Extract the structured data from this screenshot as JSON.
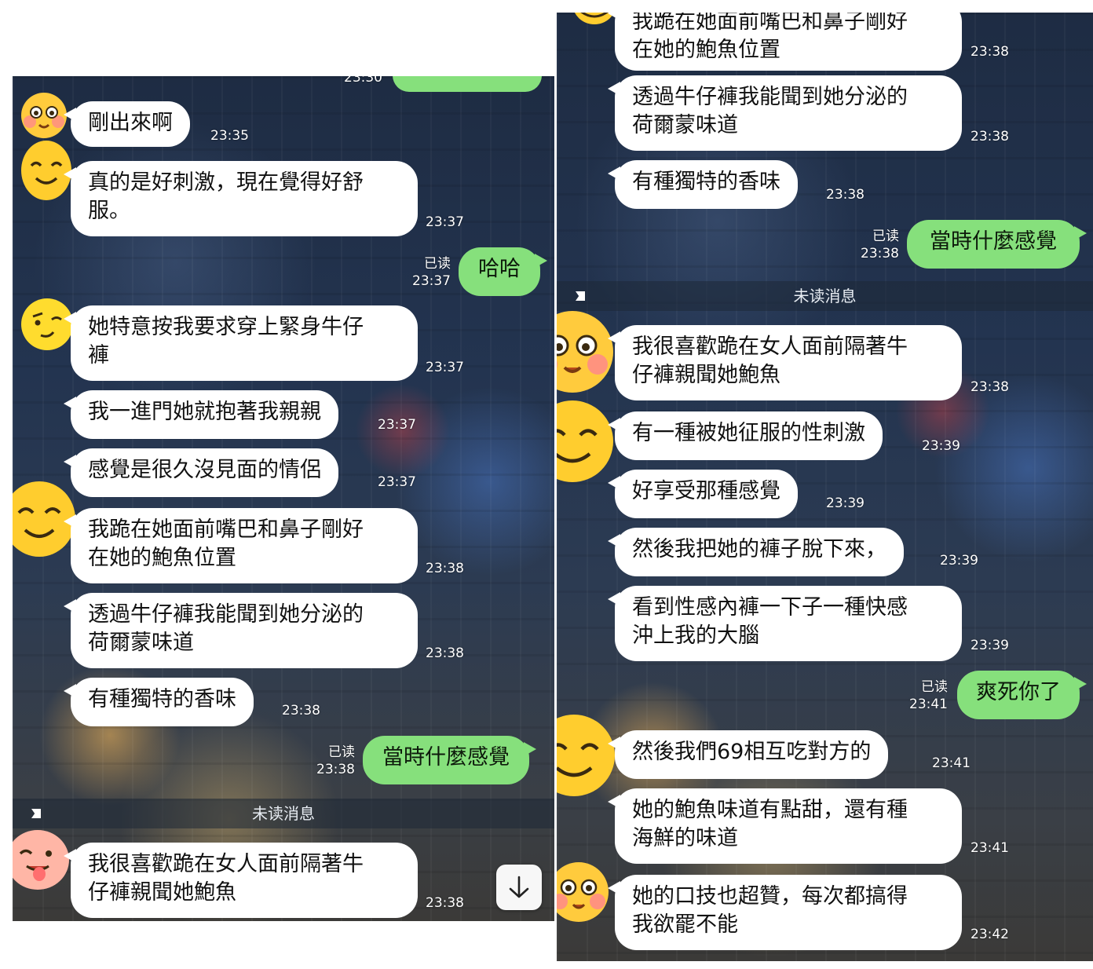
{
  "left": {
    "top_partial_time": "23:30",
    "messages": [
      {
        "text": "剛出來啊",
        "time": "23:35"
      },
      {
        "text": "真的是好刺激，現在覺得好舒\n服。",
        "time": "23:37"
      },
      {
        "text": "哈哈",
        "read": "已读",
        "time": "23:37"
      },
      {
        "text": "她特意按我要求穿上緊身牛仔\n褲",
        "time": "23:37"
      },
      {
        "text": "我一進門她就抱著我親親",
        "time": "23:37"
      },
      {
        "text": "感覺是很久沒見面的情侶",
        "time": "23:37"
      },
      {
        "text": "我跪在她面前嘴巴和鼻子剛好\n在她的鮑魚位置",
        "time": "23:38"
      },
      {
        "text": "透過牛仔褲我能聞到她分泌的\n荷爾蒙味道",
        "time": "23:38"
      },
      {
        "text": "有種獨特的香味",
        "time": "23:38"
      },
      {
        "text": "當時什麼感覺",
        "read": "已读",
        "time": "23:38"
      },
      {
        "text": "我很喜歡跪在女人面前隔著牛\n仔褲親聞她鮑魚",
        "time": "23:38"
      }
    ],
    "unread_label": "未读消息"
  },
  "right": {
    "messages": [
      {
        "text": "我跪在她面前嘴巴和鼻子剛好\n在她的鮑魚位置",
        "time": "23:38"
      },
      {
        "text": "透過牛仔褲我能聞到她分泌的\n荷爾蒙味道",
        "time": "23:38"
      },
      {
        "text": "有種獨特的香味",
        "time": "23:38"
      },
      {
        "text": "當時什麼感覺",
        "read": "已读",
        "time": "23:38"
      },
      {
        "text": "我很喜歡跪在女人面前隔著牛\n仔褲親聞她鮑魚",
        "time": "23:38"
      },
      {
        "text": "有一種被她征服的性刺激",
        "time": "23:39"
      },
      {
        "text": "好享受那種感覺",
        "time": "23:39"
      },
      {
        "text": "然後我把她的褲子脫下來，",
        "time": "23:39"
      },
      {
        "text": "看到性感內褲一下子一種快感\n沖上我的大腦",
        "time": "23:39"
      },
      {
        "text": "爽死你了",
        "read": "已读",
        "time": "23:41"
      },
      {
        "text": "然後我們69相互吃對方的",
        "time": "23:41"
      },
      {
        "text": "她的鮑魚味道有點甜，還有種\n海鮮的味道",
        "time": "23:41"
      },
      {
        "text": "她的口技也超贊，每次都搞得\n我欲罷不能",
        "time": "23:42"
      }
    ],
    "unread_label": "未读消息"
  },
  "icons": {
    "scroll_down": "arrow-down-icon",
    "unread_flag": "flag-icon",
    "avatar": "emoji-avatar-icon"
  },
  "colors": {
    "outgoing_bubble": "#86e07c",
    "incoming_bubble": "#ffffff"
  }
}
